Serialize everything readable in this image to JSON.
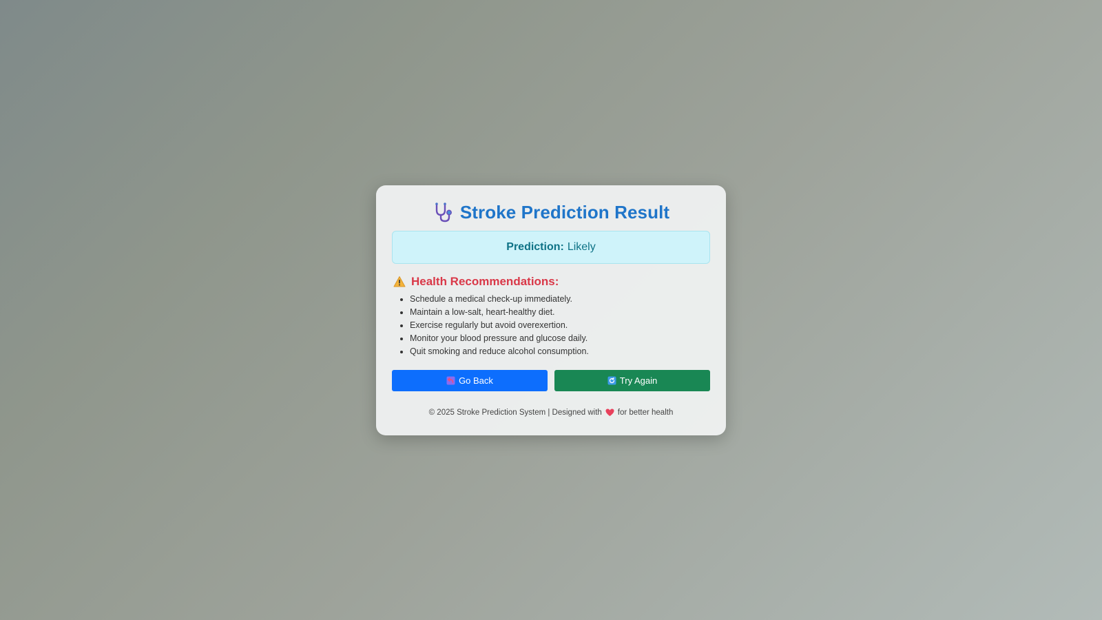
{
  "header": {
    "icon": "stethoscope-icon",
    "title": "Stroke Prediction Result"
  },
  "prediction": {
    "label": "Prediction:",
    "value": "Likely"
  },
  "recommendations": {
    "icon": "warning-icon",
    "heading": "Health Recommendations:",
    "items": [
      "Schedule a medical check-up immediately.",
      "Maintain a low-salt, heart-healthy diet.",
      "Exercise regularly but avoid overexertion.",
      "Monitor your blood pressure and glucose daily.",
      "Quit smoking and reduce alcohol consumption."
    ]
  },
  "buttons": {
    "back_label": "Go Back",
    "back_icon": "back-arrow-icon",
    "try_label": "Try Again",
    "try_icon": "refresh-icon"
  },
  "footer": {
    "prefix": "© 2025 Stroke Prediction System | Designed with",
    "icon": "heart-icon",
    "suffix": "for better health"
  },
  "colors": {
    "title": "#1f75c9",
    "prediction_bg": "#cff3fa",
    "prediction_text": "#0e7286",
    "recommendation_heading": "#d93848",
    "back_button": "#0d6efd",
    "try_button": "#198754"
  }
}
